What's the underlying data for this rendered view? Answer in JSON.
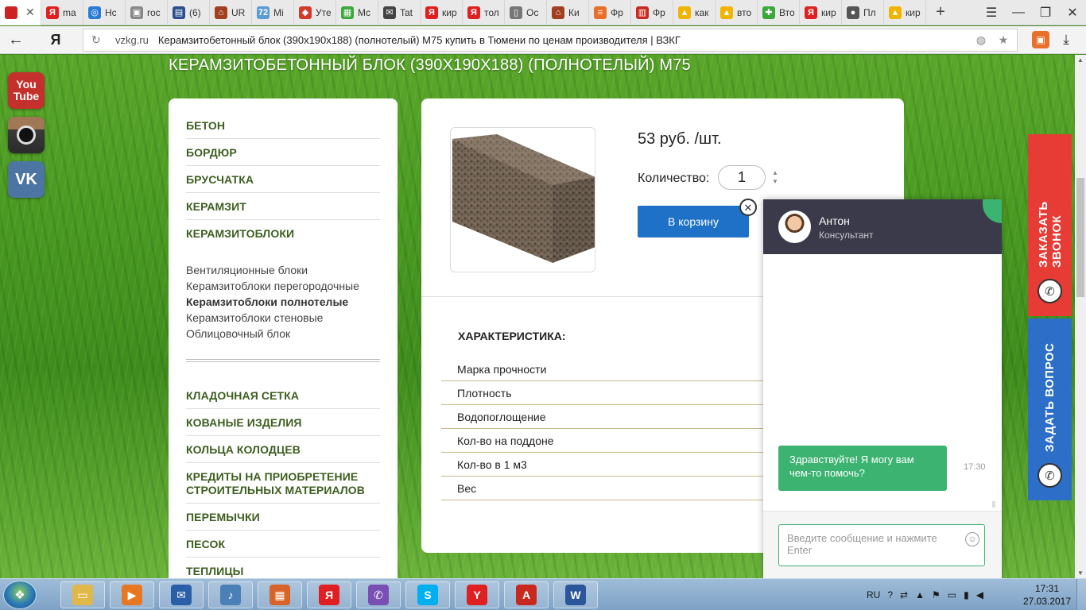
{
  "browser": {
    "tabs": [
      {
        "title": "",
        "fav": "",
        "color": "#cc2222",
        "active": true
      },
      {
        "title": "ma",
        "fav": "Я",
        "color": "#e02020"
      },
      {
        "title": "Hc",
        "fav": "◎",
        "color": "#2a7bd6"
      },
      {
        "title": "roc",
        "fav": "▣",
        "color": "#888888"
      },
      {
        "title": "(6)",
        "fav": "▤",
        "color": "#2a4f8f"
      },
      {
        "title": "UR",
        "fav": "⌂",
        "color": "#a04020"
      },
      {
        "title": "Mi",
        "fav": "72",
        "color": "#5b9bd5"
      },
      {
        "title": "Уте",
        "fav": "◆",
        "color": "#d23a2a"
      },
      {
        "title": "Mc",
        "fav": "▦",
        "color": "#3aa83a"
      },
      {
        "title": "Tat",
        "fav": "✉",
        "color": "#444444"
      },
      {
        "title": "кир",
        "fav": "Я",
        "color": "#e02020"
      },
      {
        "title": "тол",
        "fav": "Я",
        "color": "#e02020"
      },
      {
        "title": "Oc",
        "fav": "▯",
        "color": "#777777"
      },
      {
        "title": "Ки",
        "fav": "⌂",
        "color": "#a04020"
      },
      {
        "title": "Фр",
        "fav": "≡",
        "color": "#e8702a"
      },
      {
        "title": "Фр",
        "fav": "▥",
        "color": "#c8281e"
      },
      {
        "title": "как",
        "fav": "▲",
        "color": "#f1b400"
      },
      {
        "title": "вто",
        "fav": "▲",
        "color": "#f1b400"
      },
      {
        "title": "Вто",
        "fav": "✚",
        "color": "#3aa83a"
      },
      {
        "title": "кир",
        "fav": "Я",
        "color": "#e02020"
      },
      {
        "title": "Пл",
        "fav": "●",
        "color": "#555555"
      },
      {
        "title": "кир",
        "fav": "▲",
        "color": "#f1b400"
      }
    ],
    "new_tab_symbol": "+",
    "url_domain": "vzkg.ru",
    "url_title": "Керамзитобетонный блок (390х190х188) (полнотелый) М75 купить в Тюмени по ценам производителя | ВЗКГ",
    "ya_label": "Я"
  },
  "page": {
    "heading": "КЕРАМЗИТОБЕТОННЫЙ БЛОК (390Х190Х188) (ПОЛНОТЕЛЫЙ) М75",
    "social": {
      "youtube_top": "You",
      "youtube_bottom": "Tube",
      "vk": "VK"
    },
    "categories_top": [
      "БЕТОН",
      "БОРДЮР",
      "БРУСЧАТКА",
      "КЕРАМЗИТ",
      "КЕРАМЗИТОБЛОКИ"
    ],
    "subcategories": [
      "Вентиляционные блоки",
      "Керамзитоблоки перегородочные",
      "Керамзитоблоки полнотелые",
      "Керамзитоблоки стеновые",
      "Облицовочный блок"
    ],
    "active_subcategory": "Керамзитоблоки полнотелые",
    "categories_bottom": [
      "КЛАДОЧНАЯ СЕТКА",
      "КОВАНЫЕ ИЗДЕЛИЯ",
      "КОЛЬЦА КОЛОДЦЕВ",
      "КРЕДИТЫ НА ПРИОБРЕТЕНИЕ",
      "СТРОИТЕЛЬНЫХ МАТЕРИАЛОВ",
      "ПЕРЕМЫЧКИ",
      "ПЕСОК",
      "ТЕПЛИЦЫ"
    ],
    "product": {
      "price": "53 руб. /шт.",
      "qty_label": "Количество:",
      "qty_value": "1",
      "cart_button": "В корзину",
      "char_title": "ХАРАКТЕРИСТИКА:",
      "characteristics": [
        "Марка прочности",
        "Плотность",
        "Водопоглощение",
        "Кол-во на поддоне",
        "Кол-во в 1 м3",
        "Вес"
      ]
    }
  },
  "chat": {
    "agent_name": "Антон",
    "agent_role": "Консультант",
    "message": "Здравствуйте! Я могу вам чем-то помочь?",
    "time": "17:30",
    "input_placeholder": "Введите сообщение и нажмите Enter",
    "close_symbol": "✕"
  },
  "side_tabs": {
    "callback": "ЗАКАЗАТЬ ЗВОНОК",
    "question": "ЗАДАТЬ ВОПРОС"
  },
  "taskbar": {
    "lang": "RU",
    "time": "17:31",
    "date": "27.03.2017",
    "apps": [
      {
        "icon": "folder-icon",
        "glyph": "▭",
        "color": "#e0b84a"
      },
      {
        "icon": "media-player-icon",
        "glyph": "▶",
        "color": "#e87722"
      },
      {
        "icon": "mail-icon",
        "glyph": "✉",
        "color": "#2a5ea8"
      },
      {
        "icon": "speaker-icon",
        "glyph": "♪",
        "color": "#4a7fb8"
      },
      {
        "icon": "calculator-icon",
        "glyph": "▦",
        "color": "#d8642a"
      },
      {
        "icon": "yandex-icon",
        "glyph": "Я",
        "color": "#e02020"
      },
      {
        "icon": "viber-icon",
        "glyph": "✆",
        "color": "#7a4fb3"
      },
      {
        "icon": "skype-icon",
        "glyph": "S",
        "color": "#00aff0"
      },
      {
        "icon": "yandex-browser-icon",
        "glyph": "Y",
        "color": "#e02020"
      },
      {
        "icon": "autocad-icon",
        "glyph": "A",
        "color": "#c8281e"
      },
      {
        "icon": "word-icon",
        "glyph": "W",
        "color": "#2b579a"
      }
    ]
  },
  "colors": {
    "accent_green": "#3cb371",
    "cart_blue": "#1e71c6",
    "callback_red": "#e63c35",
    "question_blue": "#2d6ec9",
    "category_green": "#3d5e1f"
  }
}
